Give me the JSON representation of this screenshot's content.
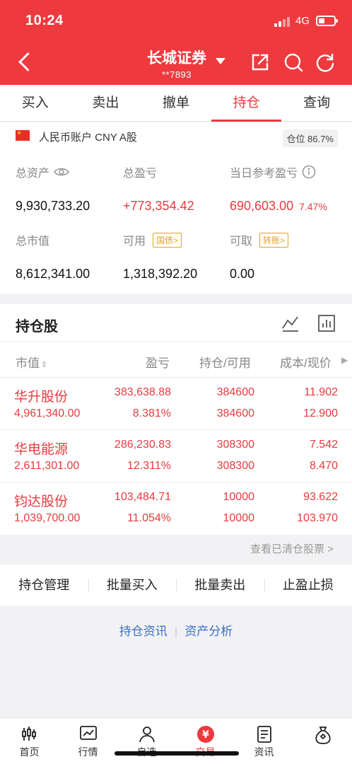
{
  "status": {
    "time": "10:24",
    "network": "4G"
  },
  "header": {
    "title": "长城证券",
    "account": "**7893"
  },
  "tabs": [
    "买入",
    "卖出",
    "撤单",
    "持仓",
    "查询"
  ],
  "account_bar": {
    "name": "人民币账户 CNY A股",
    "position_label": "仓位 86.7%"
  },
  "summary": {
    "total_assets_label": "总资产",
    "total_assets": "9,930,733.20",
    "total_pnl_label": "总盈亏",
    "total_pnl": "+773,354.42",
    "today_pnl_label": "当日参考盈亏",
    "today_pnl": "690,603.00",
    "today_pnl_pct": "7.47%",
    "market_value_label": "总市值",
    "market_value": "8,612,341.00",
    "available_label": "可用",
    "available": "1,318,392.20",
    "bond_chip": "国债>",
    "withdrawable_label": "可取",
    "withdrawable": "0.00",
    "transfer_chip": "转账>"
  },
  "holdings": {
    "title": "持仓股",
    "columns": [
      "市值",
      "盈亏",
      "持仓/可用",
      "成本/现价"
    ],
    "rows": [
      {
        "name": "华升股份",
        "market_value": "4,961,340.00",
        "pnl": "383,638.88",
        "pnl_pct": "8.381%",
        "position": "384600",
        "available": "384600",
        "cost": "11.902",
        "price": "12.900"
      },
      {
        "name": "华电能源",
        "market_value": "2,611,301.00",
        "pnl": "286,230.83",
        "pnl_pct": "12.311%",
        "position": "308300",
        "available": "308300",
        "cost": "7.542",
        "price": "8.470"
      },
      {
        "name": "钧达股份",
        "market_value": "1,039,700.00",
        "pnl": "103,484.71",
        "pnl_pct": "11.054%",
        "position": "10000",
        "available": "10000",
        "cost": "93.622",
        "price": "103.970"
      }
    ]
  },
  "cleared_link": "查看已清仓股票 >",
  "actions": [
    "持仓管理",
    "批量买入",
    "批量卖出",
    "止盈止损"
  ],
  "links": [
    "持仓资讯",
    "资产分析"
  ],
  "tabbar": [
    "首页",
    "行情",
    "自选",
    "交易",
    "资讯",
    ""
  ],
  "colors": {
    "brand_red": "#ee3a3f",
    "link_blue": "#3a6fc8",
    "chip_gold": "#e0a227"
  }
}
